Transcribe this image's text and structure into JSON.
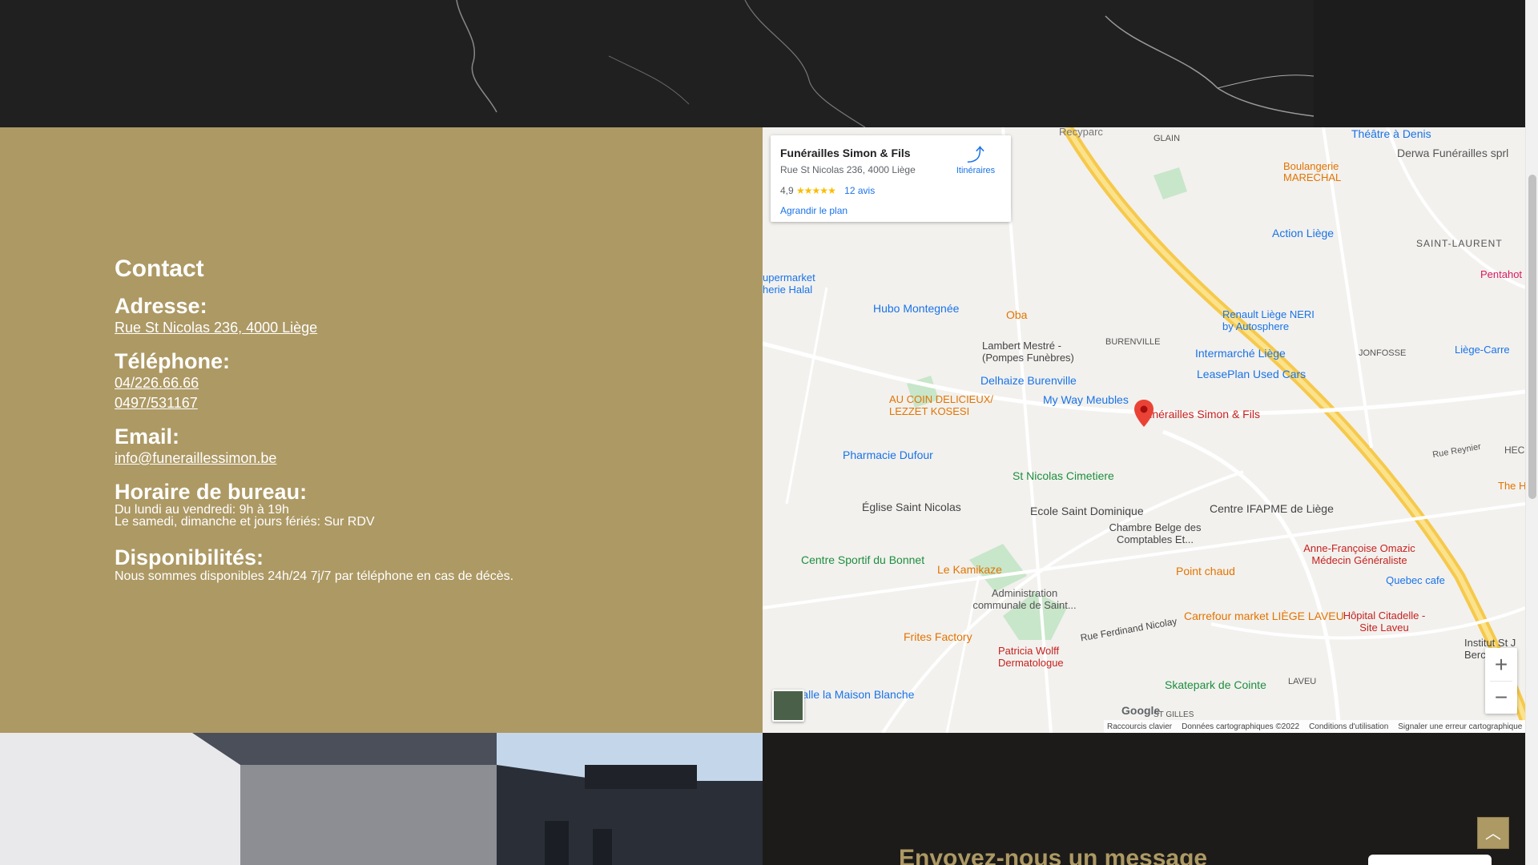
{
  "contact": {
    "title": "Contact",
    "address_heading": "Adresse:",
    "address_link": "Rue St Nicolas 236, 4000 Liège",
    "phone_heading": "Téléphone:",
    "phone_1": "04/226.66.66",
    "phone_2": "0497/531167",
    "email_heading": "Email:",
    "email_link": "info@funeraillessimon.be",
    "hours_heading": "Horaire de bureau:",
    "hours_line_1": "Du lundi au vendredi: 9h à 19h",
    "hours_line_2": "Le samedi, dimanche et jours fériés: Sur RDV",
    "availability_heading": "Disponibilités:",
    "availability_text": "Nous sommes disponibles 24h/24 7j/7 par téléphone en cas de décès."
  },
  "map": {
    "card": {
      "title": "Funérailles Simon & Fils",
      "address": "Rue St Nicolas 236, 4000 Liège",
      "rating": "4,9",
      "stars": "★★★★★",
      "reviews": "12 avis",
      "enlarge": "Agrandir le plan",
      "directions": "Itinéraires"
    },
    "attribution": {
      "shortcuts": "Raccourcis clavier",
      "data": "Données cartographiques ©2022",
      "terms": "Conditions d'utilisation",
      "report": "Signaler une erreur cartographique"
    },
    "google_logo": "Google",
    "zoom_in": "+",
    "zoom_out": "−",
    "labels": {
      "l1": "Recyparc",
      "l2": "GLAIN",
      "l3": "Théâtre à Denis",
      "l4": "Derwa Funérailles sprl",
      "l5": "Boulangerie MARECHAL",
      "l6": "Action Liège",
      "l7": "SAINT-LAURENT",
      "l8": "Pentahot",
      "l9": "upermarket herie Halal",
      "l10": "Hubo Montegnée",
      "l11": "Oba",
      "l12": "Renault Liège NERI by Autosphere",
      "l13": "Lambert Mestré - (Pompes Funèbres)",
      "l14": "BURENVILLE",
      "l15": "Intermarché Liège",
      "l16": "JONFOSSE",
      "l17": "Liège-Carre",
      "l18": "Delhaize Burenville",
      "l19": "LeasePlan Used Cars",
      "l20": "AU COIN DELICIEUX/ LEZZET KOSESI",
      "l21": "My Way Meubles",
      "l22": "Funérailles Simon & Fils",
      "l23": "Pharmacie Dufour",
      "l24": "St Nicolas Cimetiere",
      "l25": "Église Saint Nicolas",
      "l26": "Ecole Saint Dominique",
      "l27": "Centre IFAPME de Liège",
      "l28": "Chambre Belge des Comptables Et...",
      "l29": "Centre Sportif du Bonnet",
      "l30": "Le Kamikaze",
      "l31": "Point chaud",
      "l32": "Anne-Françoise Omazic Médecin Généraliste",
      "l33": "Administration communale de Saint...",
      "l34": "Quebec cafe",
      "l35": "Carrefour market LIÈGE LAVEU",
      "l36": "Hôpital Citadelle - Site Laveu",
      "l37": "Frites Factory",
      "l38": "Patricia Wolff Dermatologue",
      "l39": "Rue Ferdinand Nicolay",
      "l40": "Skatepark de Cointe",
      "l41": "Salle la Maison Blanche",
      "l42": "LAVEU",
      "l43": "ST GILLES",
      "l44": "HEC",
      "l45": "Rue Reynier",
      "l46": "The Hu",
      "l47": "Institut St J Berchman"
    }
  },
  "form": {
    "heading": "Envoyez-nous un message"
  },
  "scroll_top_icon": "chevron-up-icon"
}
